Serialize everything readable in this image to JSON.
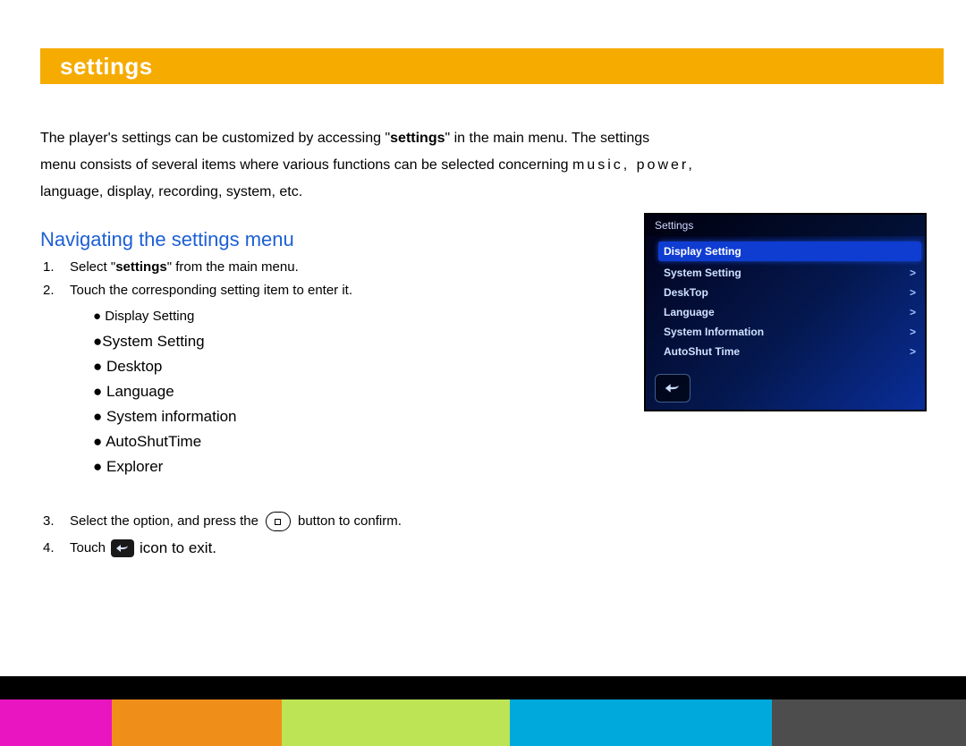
{
  "header": {
    "title": "settings"
  },
  "intro": {
    "line1a": "The player's settings can be customized by accessing \"",
    "kw": "settings",
    "line1b": "\" in the main menu. The settings",
    "line2a": "menu consists of several items where various functions can be selected concerning ",
    "tracked": "music, power,",
    "line3": "language, display, recording, system, etc."
  },
  "subheading": "Navigating the settings menu",
  "steps": {
    "s1_num": "1.",
    "s1a": "Select \"",
    "s1kw": "settings",
    "s1b": "\" from the main menu.",
    "s2_num": "2.",
    "s2": "Touch the corresponding setting item to enter it.",
    "s3_num": "3.",
    "s3a": "Select the option, and press the",
    "s3b": "button to confirm.",
    "s4_num": "4.",
    "s4a": "Touch",
    "s4b": "icon to exit."
  },
  "bullets": [
    "Display Setting",
    "System Setting",
    "Desktop",
    "Language",
    "System information",
    "AutoShutTime",
    "Explorer"
  ],
  "device": {
    "title": "Settings",
    "items": [
      "Display Setting",
      "System Setting",
      "DeskTop",
      "Language",
      "System Information",
      "AutoShut Time"
    ]
  },
  "chevron": ">",
  "dot": "●"
}
